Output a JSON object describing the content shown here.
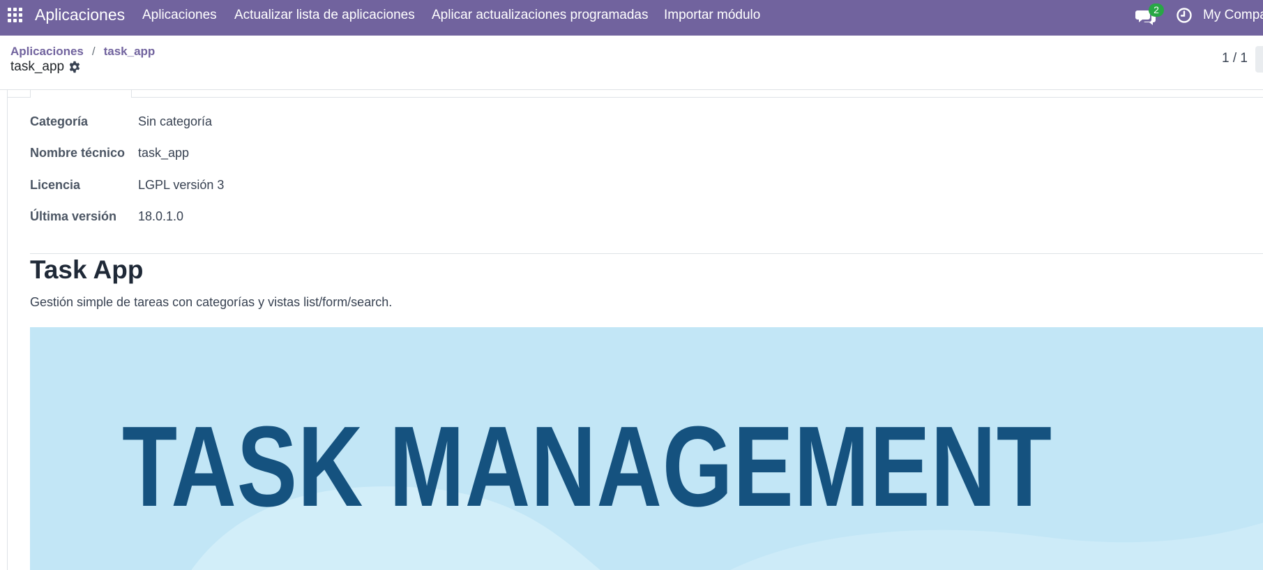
{
  "navbar": {
    "brand": "Aplicaciones",
    "menu": [
      "Aplicaciones",
      "Actualizar lista de aplicaciones",
      "Aplicar actualizaciones programadas",
      "Importar módulo"
    ],
    "messages_count": "2",
    "company": "My Compa",
    "color": "#71639e"
  },
  "breadcrumb": {
    "parent": "Aplicaciones",
    "separator": "/",
    "current": "task_app"
  },
  "record": {
    "title": "task_app",
    "pager": "1 / 1"
  },
  "fields": [
    {
      "label": "Categoría",
      "value": "Sin categoría"
    },
    {
      "label": "Nombre técnico",
      "value": "task_app"
    },
    {
      "label": "Licencia",
      "value": "LGPL versión 3"
    },
    {
      "label": "Última versión",
      "value": "18.0.1.0"
    }
  ],
  "description": {
    "title": "Task App",
    "text": "Gestión simple de tareas con categorías y vistas list/form/search."
  },
  "banner": {
    "text": "TASK MANAGEMENT",
    "background": "#c2e6f6",
    "text_color": "#15527f"
  },
  "icons": [
    "apps-grid-icon",
    "chat-icon",
    "clock-icon",
    "gear-icon"
  ]
}
